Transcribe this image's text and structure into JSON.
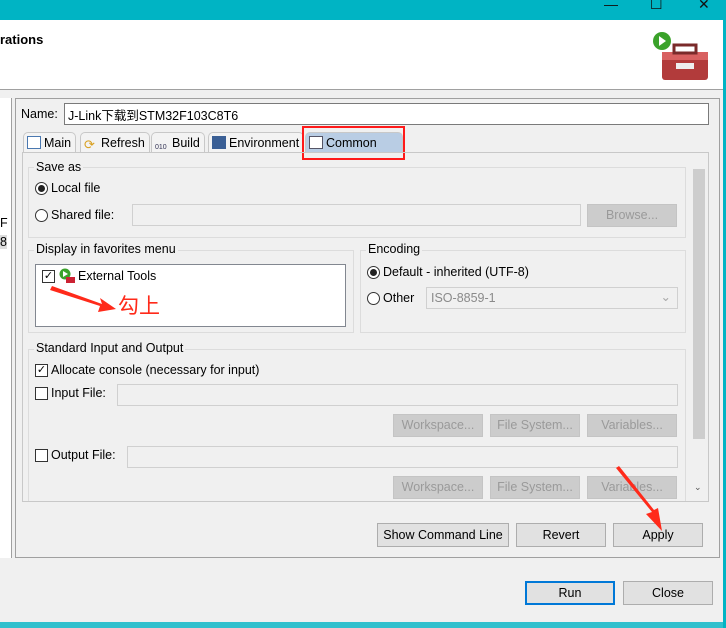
{
  "window": {
    "title_fragment": "rations",
    "minimize": "—",
    "maximize": "☐",
    "close": "✕"
  },
  "left_panel": {
    "items": [
      "F",
      "8"
    ]
  },
  "name": {
    "label": "Name:",
    "value": "J-Link下载到STM32F103C8T6"
  },
  "tabs": [
    {
      "label": "Main",
      "icon": "main-tab-icon"
    },
    {
      "label": "Refresh",
      "icon": "refresh-icon"
    },
    {
      "label": "Build",
      "icon": "build-icon"
    },
    {
      "label": "Environment",
      "icon": "environment-icon"
    },
    {
      "label": "Common",
      "icon": "common-icon",
      "selected": true
    }
  ],
  "save_as": {
    "title": "Save as",
    "local_file": "Local file",
    "shared_file": "Shared file:",
    "browse": "Browse...",
    "selected": "Local file"
  },
  "favorites": {
    "title": "Display in favorites menu",
    "items": [
      {
        "label": "External Tools",
        "checked": true
      }
    ]
  },
  "encoding": {
    "title": "Encoding",
    "default": "Default - inherited (UTF-8)",
    "other": "Other",
    "other_value": "ISO-8859-1",
    "selected": "Default"
  },
  "std_io": {
    "title": "Standard Input and Output",
    "allocate_console": "Allocate console (necessary for input)",
    "allocate_checked": true,
    "input_file": "Input File:",
    "output_file": "Output File:",
    "workspace": "Workspace...",
    "file_system": "File System...",
    "variables": "Variables..."
  },
  "buttons": {
    "show_command_line": "Show Command Line",
    "revert": "Revert",
    "apply": "Apply",
    "run": "Run",
    "close": "Close"
  },
  "annotation": {
    "text": "勾上",
    "color": "#ff2a1a"
  },
  "colors": {
    "titlebar": "#00b4c4",
    "highlight_box": "#ff1a1a",
    "default_button_border": "#0078d7"
  }
}
